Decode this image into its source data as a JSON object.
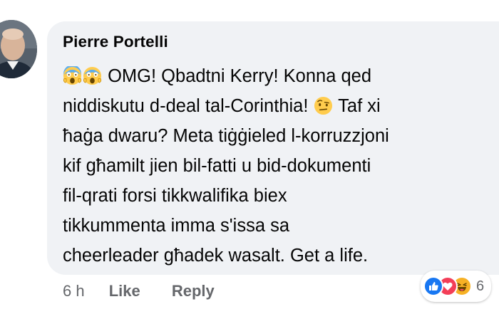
{
  "comment": {
    "author": "Pierre Portelli",
    "lines": [
      "OMG! Qbadtni Kerry! Konna qed",
      "niddiskutu d-deal tal-Corinthia!",
      "Taf xi",
      "ħaġa dwaru? Meta tiġġieled l-korruzzjoni",
      "kif għamilt jien bil-fatti u bid-dokumenti",
      "fil-qrati forsi tikkwalifika biex",
      "tikkummenta imma s'issa sa",
      "cheerleader għadek wasalt. Get a life."
    ],
    "emojis": {
      "start": [
        "scream-emoji",
        "scream-emoji"
      ],
      "after_line_2": "raised-eyebrow-emoji"
    }
  },
  "actions": {
    "time": "6 h",
    "like": "Like",
    "reply": "Reply"
  },
  "reactions": {
    "icons": [
      "like-reaction-icon",
      "love-reaction-icon",
      "haha-reaction-icon"
    ],
    "count": "6",
    "colors": {
      "like": "#1877f2",
      "love": "#f33e58",
      "haha": "#f7b125"
    }
  },
  "theme": {
    "bubble_bg": "#f0f2f5",
    "text": "#050505",
    "meta": "#65676b"
  }
}
